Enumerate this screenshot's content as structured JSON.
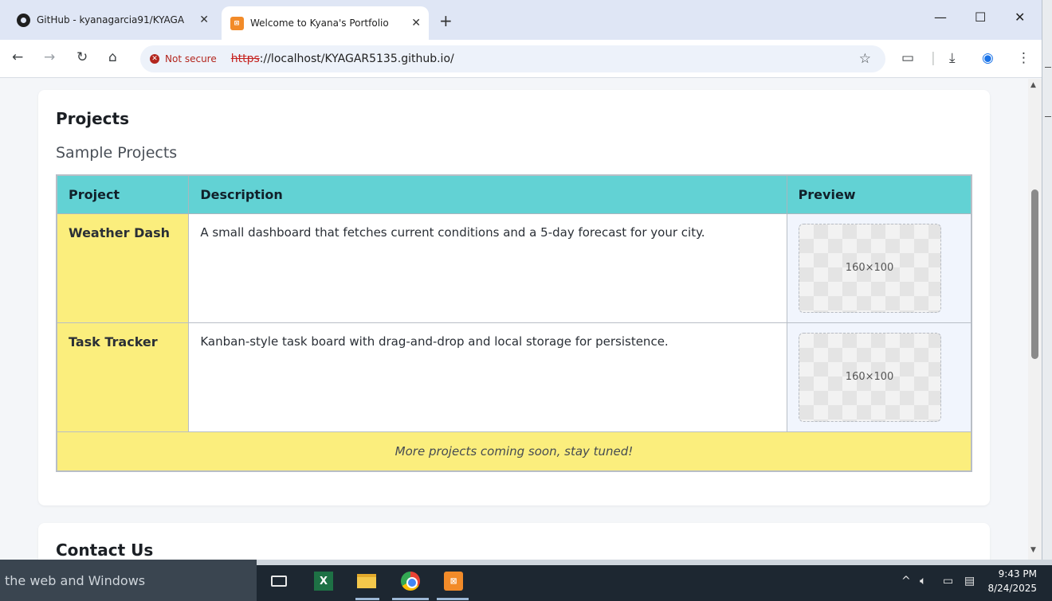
{
  "browser": {
    "tabs": [
      {
        "title": "GitHub - kyanagarcia91/KYAGA",
        "icon": "github-icon",
        "active": false
      },
      {
        "title": "Welcome to Kyana's Portfolio",
        "icon": "xampp-icon",
        "active": true
      }
    ],
    "new_tab": "+",
    "window_controls": {
      "minimize": "—",
      "maximize": "☐",
      "close": "✕"
    },
    "security_label": "Not secure",
    "url_scheme": "https",
    "url_rest": "://localhost/KYAGAR5135.github.io/"
  },
  "page": {
    "projects_heading": "Projects",
    "sample_heading": "Sample Projects",
    "table": {
      "headers": [
        "Project",
        "Description",
        "Preview"
      ],
      "rows": [
        {
          "name": "Weather Dash",
          "description": "A small dashboard that fetches current conditions and a 5-day forecast for your city.",
          "preview": "160×100"
        },
        {
          "name": "Task Tracker",
          "description": "Kanban-style task board with drag-and-drop and local storage for persistence.",
          "preview": "160×100"
        }
      ],
      "footer": "More projects coming soon, stay tuned!"
    },
    "contact_heading": "Contact Us"
  },
  "taskbar": {
    "search_text": "the web and Windows",
    "time": "9:43 PM",
    "date": "8/24/2025"
  },
  "colors": {
    "header_cyan": "#62d2d4",
    "project_yellow": "#fbee7d",
    "preview_bg": "#f1f5fd"
  }
}
